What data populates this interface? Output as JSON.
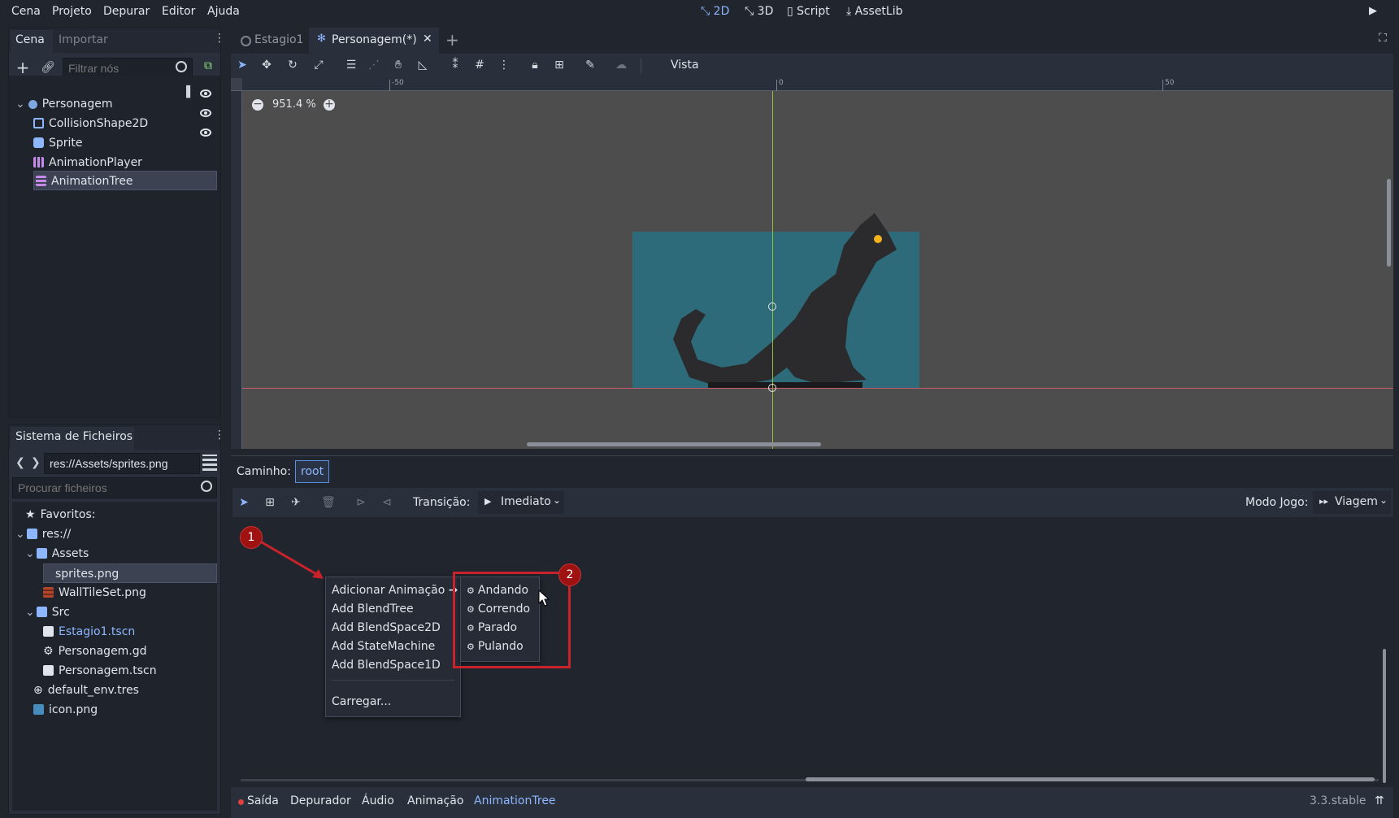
{
  "menubar": {
    "items": [
      "Cena",
      "Projeto",
      "Depurar",
      "Editor",
      "Ajuda"
    ],
    "workspaces": [
      "2D",
      "3D",
      "Script",
      "AssetLib"
    ],
    "active_workspace": "2D"
  },
  "scene_dock": {
    "tabs": [
      "Cena",
      "Importar"
    ],
    "filter_placeholder": "Filtrar nós",
    "nodes": [
      {
        "label": "Personagem",
        "icon": "kinematic-body-icon"
      },
      {
        "label": "CollisionShape2D",
        "icon": "collision-shape-icon"
      },
      {
        "label": "Sprite",
        "icon": "sprite-icon"
      },
      {
        "label": "AnimationPlayer",
        "icon": "animation-player-icon"
      },
      {
        "label": "AnimationTree",
        "icon": "animation-tree-icon",
        "selected": true
      }
    ]
  },
  "filesystem_dock": {
    "title": "Sistema de Ficheiros",
    "path": "res://Assets/sprites.png",
    "search_placeholder": "Procurar ficheiros",
    "items": [
      {
        "label": "Favoritos:",
        "icon": "star-icon"
      },
      {
        "label": "res://",
        "icon": "folder-icon"
      },
      {
        "label": "Assets",
        "icon": "folder-icon"
      },
      {
        "label": "sprites.png",
        "icon": "image-icon",
        "selected": true
      },
      {
        "label": "WallTileSet.png",
        "icon": "image-icon"
      },
      {
        "label": "Src",
        "icon": "folder-icon"
      },
      {
        "label": "Estagio1.tscn",
        "icon": "scene-icon"
      },
      {
        "label": "Personagem.gd",
        "icon": "gear-icon"
      },
      {
        "label": "Personagem.tscn",
        "icon": "scene-icon"
      },
      {
        "label": "default_env.tres",
        "icon": "globe-icon"
      },
      {
        "label": "icon.png",
        "icon": "image-icon"
      }
    ]
  },
  "editor_tabs": [
    "Estagio1",
    "Personagem(*)"
  ],
  "toolbar": {
    "view_label": "Vista"
  },
  "viewport": {
    "zoom": "951.4 %",
    "ruler_ticks": [
      "-50",
      "0",
      "50"
    ]
  },
  "animtree": {
    "path_label": "Caminho:",
    "path_value": "root",
    "transition_label": "Transição:",
    "transition_value": "Imediato",
    "play_mode_label": "Modo Jogo:",
    "play_mode_value": "Viagem",
    "context_menu": [
      "Adicionar Animação",
      "Add BlendTree",
      "Add BlendSpace2D",
      "Add StateMachine",
      "Add BlendSpace1D",
      "Carregar..."
    ],
    "submenu": [
      "Andando",
      "Correndo",
      "Parado",
      "Pulando"
    ],
    "badges": [
      "1",
      "2"
    ]
  },
  "bottom_tabs": [
    "Saída",
    "Depurador",
    "Áudio",
    "Animação",
    "AnimationTree"
  ],
  "active_bottom_tab": "AnimationTree",
  "version": "3.3.stable",
  "colors": {
    "accent": "#8eb6ff",
    "selection": "#3c4252",
    "annotation": "#c8222b",
    "sprite_bg": "#2d6b7a"
  }
}
